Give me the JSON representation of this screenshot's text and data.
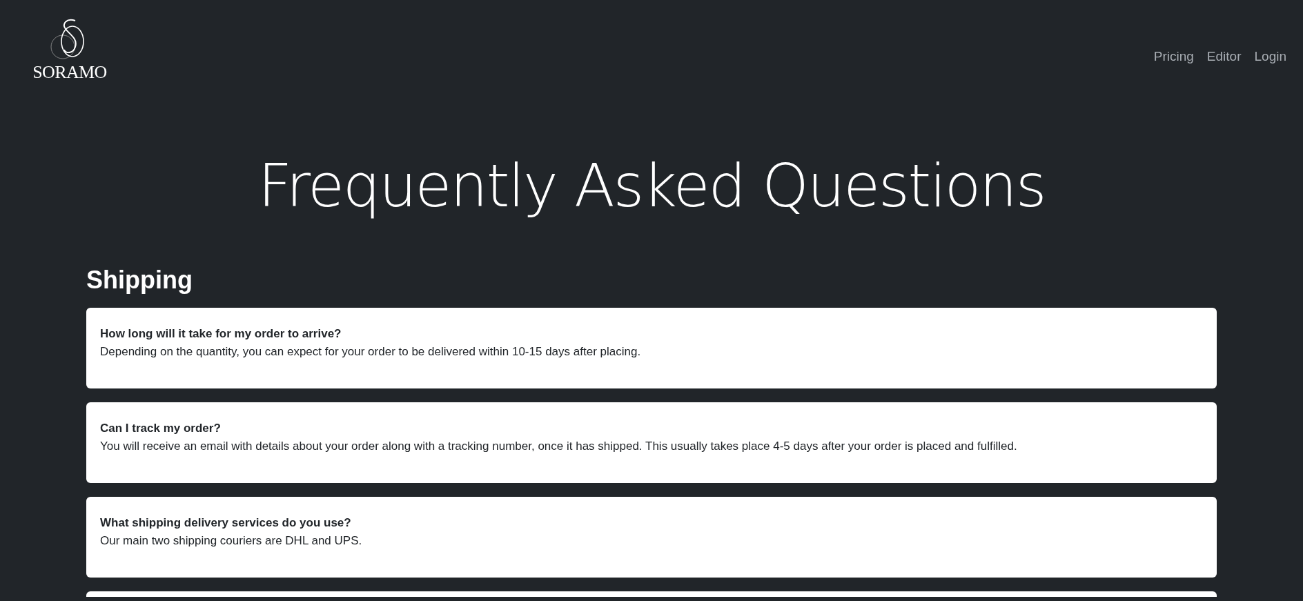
{
  "header": {
    "logo_text": "SORAMO",
    "nav": [
      "Pricing",
      "Editor",
      "Login"
    ]
  },
  "page_title": "Frequently Asked Questions",
  "sections": [
    {
      "title": "Shipping",
      "items": [
        {
          "question": "How long will it take for my order to arrive?",
          "answer": "Depending on the quantity, you can expect for your order to be delivered within 10-15 days after placing."
        },
        {
          "question": "Can I track my order?",
          "answer": "You will receive an email with details about your order along with a tracking number, once it has shipped. This usually takes place 4-5 days after your order is placed and fulfilled."
        },
        {
          "question": "What shipping delivery services do you use?",
          "answer": "Our main two shipping couriers are DHL and UPS."
        }
      ]
    }
  ]
}
